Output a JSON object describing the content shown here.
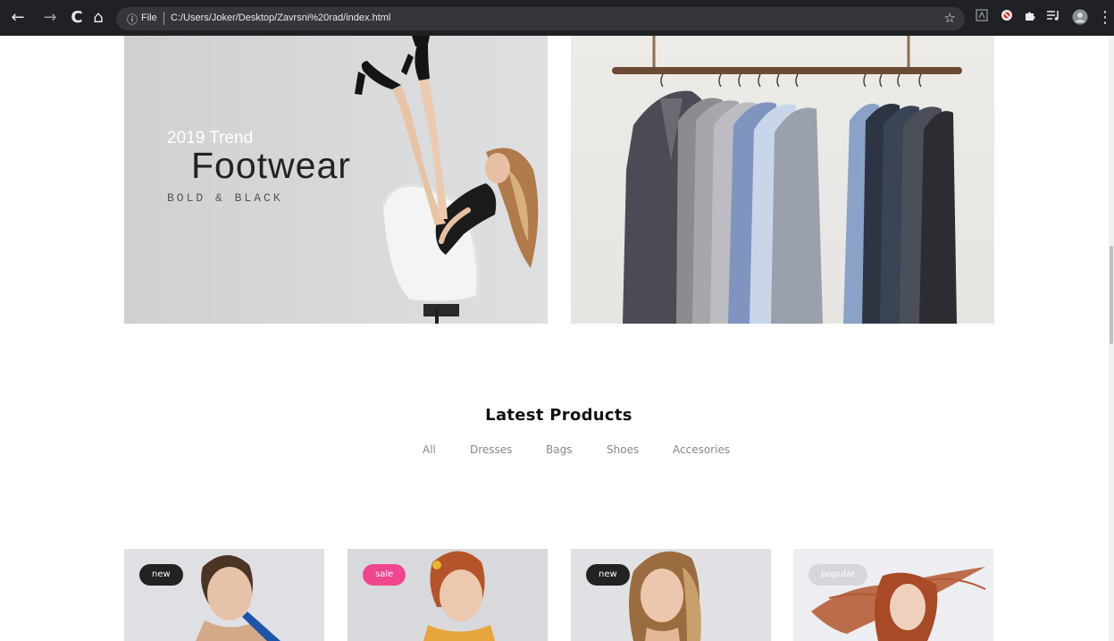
{
  "browser": {
    "back_icon": "←",
    "forward_icon": "→",
    "reload_icon": "C",
    "home_icon": "⌂",
    "info_icon": "ⓘ",
    "file_label": "File",
    "url": "C:/Users/Joker/Desktop/Zavrsni%20rad/index.html",
    "star_icon": "☆",
    "menu_icon": "⋮"
  },
  "banners": {
    "left": {
      "trend": "2019 Trend",
      "title": "Footwear",
      "subtitle": "BOLD & BLACK"
    }
  },
  "section": {
    "title": "Latest Products"
  },
  "filters": [
    "All",
    "Dresses",
    "Bags",
    "Shoes",
    "Accesories"
  ],
  "products": [
    {
      "badge": "new",
      "badge_color": "#222222"
    },
    {
      "badge": "sale",
      "badge_color": "#f0468f"
    },
    {
      "badge": "new",
      "badge_color": "#222222"
    },
    {
      "badge": "popular",
      "badge_color": "#d5d7dc"
    }
  ],
  "colors": {
    "chrome": "#202124",
    "sale": "#f0468f",
    "new": "#222222"
  }
}
